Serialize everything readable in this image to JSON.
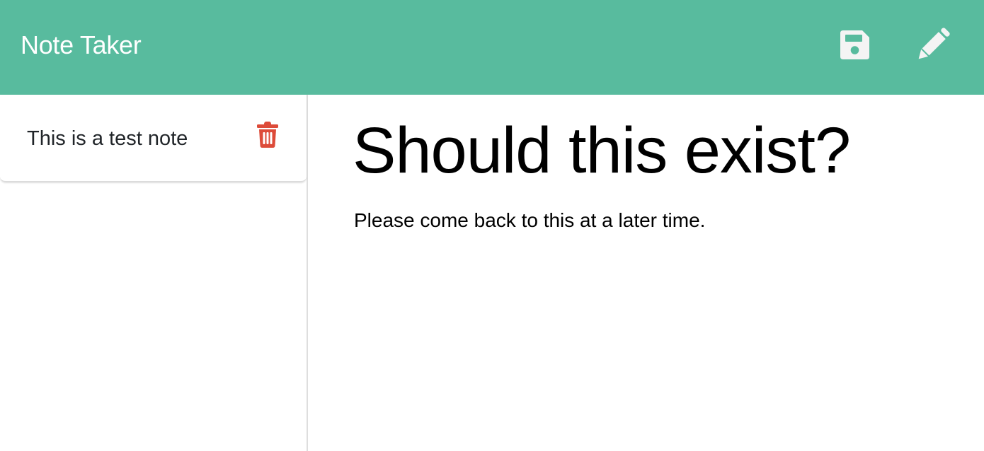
{
  "app": {
    "title": "Note Taker"
  },
  "toolbar": {
    "save_icon": "save-floppy-icon",
    "new_note_icon": "pencil-icon",
    "icon_color": "#f4f4f4"
  },
  "theme": {
    "accent": "#58bb9e",
    "delete_color": "#dd4b39"
  },
  "sidebar": {
    "notes": [
      {
        "title": "This is a test note",
        "delete_icon": "trash-icon"
      }
    ]
  },
  "active_note": {
    "title": "Should this exist?",
    "text": "Please come back to this at a later time."
  }
}
